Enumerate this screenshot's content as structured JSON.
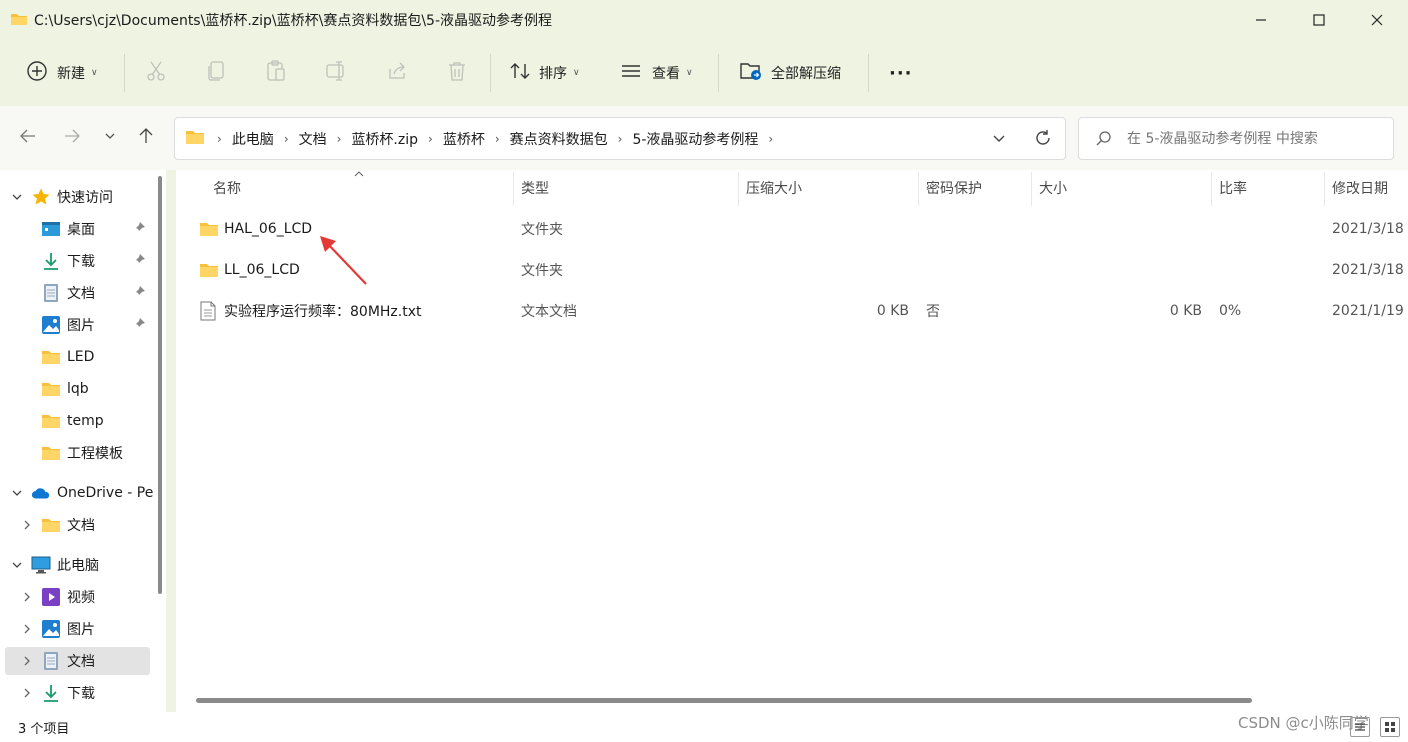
{
  "window": {
    "title": "C:\\Users\\cjz\\Documents\\蓝桥杯.zip\\蓝桥杯\\赛点资料数据包\\5-液晶驱动参考例程"
  },
  "toolbar": {
    "new_label": "新建",
    "sort_label": "排序",
    "view_label": "查看",
    "extract_all_label": "全部解压缩",
    "more_label": "···"
  },
  "address": {
    "crumbs": [
      "此电脑",
      "文档",
      "蓝桥杯.zip",
      "蓝桥杯",
      "赛点资料数据包",
      "5-液晶驱动参考例程"
    ]
  },
  "search": {
    "placeholder": "在 5-液晶驱动参考例程 中搜索"
  },
  "sidebar": {
    "items": [
      {
        "label": "快速访问",
        "icon": "star-icon"
      },
      {
        "label": "桌面",
        "icon": "desktop-icon"
      },
      {
        "label": "下载",
        "icon": "download-icon"
      },
      {
        "label": "文档",
        "icon": "document-icon"
      },
      {
        "label": "图片",
        "icon": "pictures-icon"
      },
      {
        "label": "LED",
        "icon": "folder-icon"
      },
      {
        "label": "lqb",
        "icon": "folder-icon"
      },
      {
        "label": "temp",
        "icon": "folder-icon"
      },
      {
        "label": "工程模板",
        "icon": "folder-icon"
      },
      {
        "label": "OneDrive - Pe",
        "icon": "onedrive-icon"
      },
      {
        "label": "文档",
        "icon": "folder-icon"
      },
      {
        "label": "此电脑",
        "icon": "computer-icon"
      },
      {
        "label": "视频",
        "icon": "video-icon"
      },
      {
        "label": "图片",
        "icon": "pictures-icon"
      },
      {
        "label": "文档",
        "icon": "document-icon"
      },
      {
        "label": "下载",
        "icon": "download-icon"
      }
    ]
  },
  "columns": {
    "name": "名称",
    "type": "类型",
    "compressed_size": "压缩大小",
    "password": "密码保护",
    "size": "大小",
    "ratio": "比率",
    "modified": "修改日期"
  },
  "files": [
    {
      "name": "HAL_06_LCD",
      "type": "文件夹",
      "compressed_size": "",
      "password": "",
      "size": "",
      "ratio": "",
      "modified": "2021/3/18",
      "icon": "folder-icon"
    },
    {
      "name": "LL_06_LCD",
      "type": "文件夹",
      "compressed_size": "",
      "password": "",
      "size": "",
      "ratio": "",
      "modified": "2021/3/18",
      "icon": "folder-icon"
    },
    {
      "name": "实验程序运行频率：80MHz.txt",
      "type": "文本文档",
      "compressed_size": "0 KB",
      "password": "否",
      "size": "0 KB",
      "ratio": "0%",
      "modified": "2021/1/19",
      "icon": "text-file-icon"
    }
  ],
  "status": {
    "item_count": "3 个项目"
  },
  "watermark": "CSDN @c小陈同学",
  "colors": {
    "toolbar_bg": "#eef3e2",
    "folder": "#f6c23e",
    "accent": "#0067c0",
    "arrow_annotation": "#e53935"
  }
}
